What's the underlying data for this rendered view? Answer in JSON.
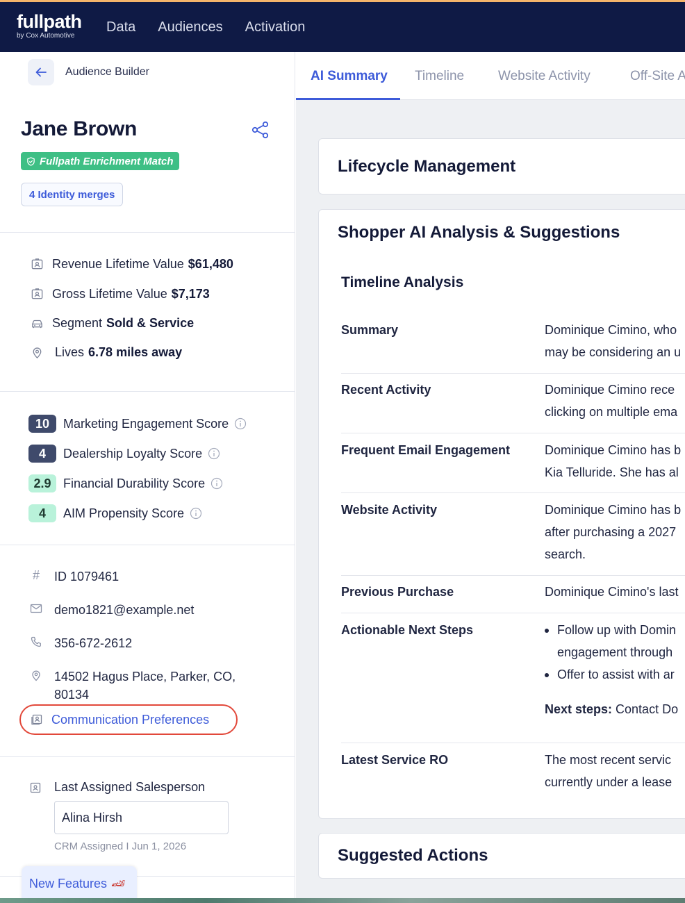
{
  "nav": {
    "logo": "fullpath",
    "logo_sub": "by Cox Automotive",
    "items": [
      "Data",
      "Audiences",
      "Activation"
    ]
  },
  "profile": {
    "breadcrumb": "Audience Builder",
    "name": "Jane Brown",
    "enrichment_badge": "Fullpath Enrichment Match",
    "identity_merges": "4 Identity merges"
  },
  "metrics": [
    {
      "label": "Revenue Lifetime Value",
      "value": "$61,480",
      "icon": "badge-icon"
    },
    {
      "label": "Gross Lifetime Value",
      "value": "$7,173",
      "icon": "badge-icon"
    },
    {
      "label": "Segment",
      "value": "Sold & Service",
      "icon": "car-icon"
    },
    {
      "label": "Lives",
      "value": "6.78 miles away",
      "icon": "location-pin-icon"
    }
  ],
  "scores": [
    {
      "value": "10",
      "label": "Marketing Engagement Score",
      "style": "dark"
    },
    {
      "value": "4",
      "label": "Dealership Loyalty Score",
      "style": "dark"
    },
    {
      "value": "2.9",
      "label": "Financial Durability Score",
      "style": "light"
    },
    {
      "value": "4",
      "label": "AIM Propensity Score",
      "style": "light"
    }
  ],
  "contact": {
    "id": "ID 1079461",
    "email": "demo1821@example.net",
    "phone": "356-672-2612",
    "address_line1": "14502 Hagus Place, Parker, CO,",
    "address_line2": "80134",
    "comm_prefs": "Communication Preferences"
  },
  "salesperson": {
    "label": "Last Assigned Salesperson",
    "value": "Alina Hirsh",
    "crm": "CRM Assigned I Jun 1, 2026"
  },
  "new_features": "New Features",
  "tabs": [
    "AI Summary",
    "Timeline",
    "Website Activity",
    "Off-Site A"
  ],
  "lifecycle": {
    "title": "Lifecycle Management"
  },
  "analysis": {
    "title": "Shopper AI Analysis & Suggestions",
    "subtitle": "Timeline Analysis",
    "rows": [
      {
        "label": "Summary",
        "lines": [
          "Dominique Cimino, who",
          "may be considering an u"
        ]
      },
      {
        "label": "Recent Activity",
        "lines": [
          "Dominique Cimino rece",
          "clicking on multiple ema"
        ]
      },
      {
        "label": "Frequent Email Engagement",
        "lines": [
          "Dominique Cimino has b",
          "Kia Telluride. She has al"
        ]
      },
      {
        "label": "Website Activity",
        "lines": [
          "Dominique Cimino has b",
          "after purchasing a 2027",
          "search."
        ]
      },
      {
        "label": "Previous Purchase",
        "lines": [
          "Dominique Cimino's last"
        ]
      },
      {
        "label": "Actionable Next Steps",
        "bullets": [
          "Follow up with Domin",
          "engagement through",
          "Offer to assist with ar"
        ],
        "next_label": "Next steps:",
        "next_value": " Contact Do"
      },
      {
        "label": "Latest Service RO",
        "lines": [
          "The most recent servic",
          "currently under a lease"
        ]
      }
    ]
  },
  "suggested": {
    "title": "Suggested Actions"
  }
}
